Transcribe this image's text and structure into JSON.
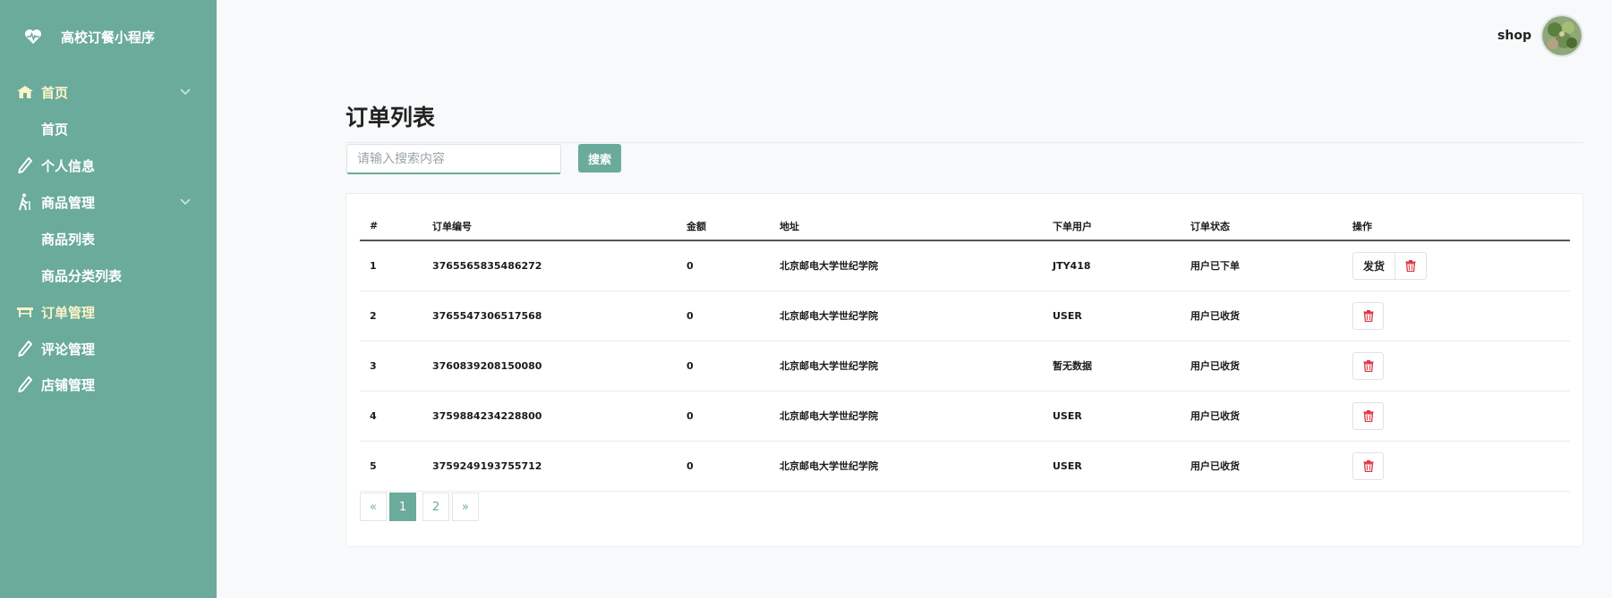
{
  "brand": {
    "title": "高校订餐小程序"
  },
  "sidebar": {
    "items": [
      {
        "label": "首页",
        "icon": "home-icon",
        "expandable": true
      },
      {
        "label": "首页",
        "icon": "",
        "sub": true
      },
      {
        "label": "个人信息",
        "icon": "pencil-icon"
      },
      {
        "label": "商品管理",
        "icon": "walker-icon",
        "expandable": true
      },
      {
        "label": "商品列表",
        "sub": true
      },
      {
        "label": "商品分类列表",
        "sub": true
      },
      {
        "label": "订单管理",
        "icon": "table-icon",
        "active": true
      },
      {
        "label": "评论管理",
        "icon": "pencil-icon"
      },
      {
        "label": "店铺管理",
        "icon": "pencil-icon"
      }
    ]
  },
  "header": {
    "username": "shop"
  },
  "page": {
    "title": "订单列表"
  },
  "search": {
    "placeholder": "请输入搜索内容",
    "button_label": "搜索"
  },
  "table": {
    "columns": [
      "#",
      "订单编号",
      "金额",
      "地址",
      "下单用户",
      "订单状态",
      "操作"
    ],
    "rows": [
      {
        "index": "1",
        "order_no": "3765565835486272",
        "amount": "0",
        "address": "北京邮电大学世纪学院",
        "user": "JTY418",
        "status": "用户已下单",
        "ship_label": "发货"
      },
      {
        "index": "2",
        "order_no": "3765547306517568",
        "amount": "0",
        "address": "北京邮电大学世纪学院",
        "user": "USER",
        "status": "用户已收货"
      },
      {
        "index": "3",
        "order_no": "3760839208150080",
        "amount": "0",
        "address": "北京邮电大学世纪学院",
        "user": "暂无数据",
        "status": "用户已收货"
      },
      {
        "index": "4",
        "order_no": "3759884234228800",
        "amount": "0",
        "address": "北京邮电大学世纪学院",
        "user": "USER",
        "status": "用户已收货"
      },
      {
        "index": "5",
        "order_no": "3759249193755712",
        "amount": "0",
        "address": "北京邮电大学世纪学院",
        "user": "USER",
        "status": "用户已收货"
      }
    ]
  },
  "pagination": {
    "prev": "«",
    "pages": [
      "1",
      "2"
    ],
    "current": "1",
    "next": "»"
  },
  "colors": {
    "accent": "#6aab9b",
    "active_nav": "#fdf3c8",
    "danger": "#dc3545"
  }
}
